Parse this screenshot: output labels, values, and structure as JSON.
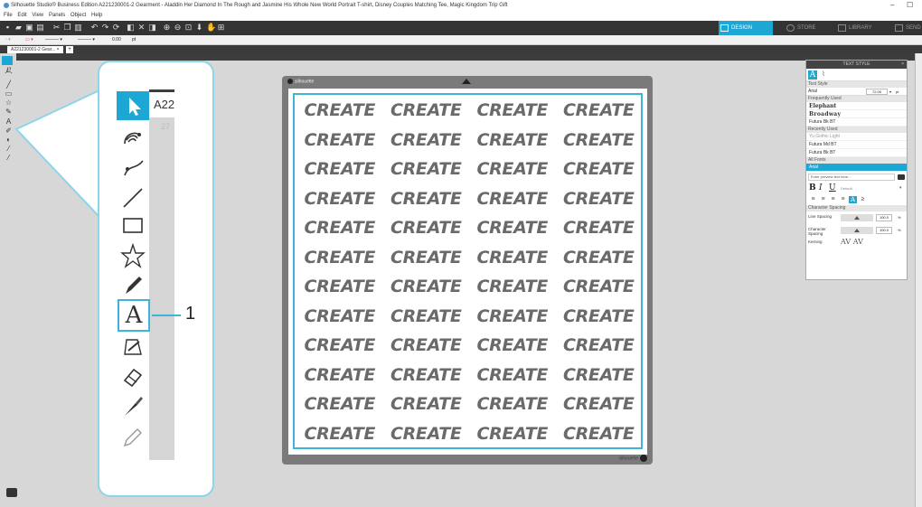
{
  "window": {
    "title": "Silhouette Studio® Business Edition A221230001-2 Gearment - Aladdin Her Diamond In The Rough and Jasmine His Whole New World Portrait T-shirt, Disney Couples Matching Tee, Magic Kingdom Trip Gift",
    "minimize": "–",
    "maximize": "☐"
  },
  "menu": [
    "File",
    "Edit",
    "View",
    "Panels",
    "Object",
    "Help"
  ],
  "mode_tabs": [
    {
      "label": "DESIGN",
      "active": true
    },
    {
      "label": "STORE",
      "active": false
    },
    {
      "label": "LIBRARY",
      "active": false
    },
    {
      "label": "SEND",
      "active": false
    }
  ],
  "options_bar": {
    "stroke_value": "0.00",
    "unit": "pt"
  },
  "doc_tab": {
    "label": "A221230001-2 Gear...",
    "close": "×",
    "add": "+"
  },
  "mat": {
    "logo": "silhouette",
    "brand": "silhouette",
    "word": "CREATE",
    "rows": 12,
    "cols": 4
  },
  "text_panel": {
    "title": "TEXT STYLE",
    "close": "×",
    "text_style_label": "Text Style",
    "font": "Arial",
    "font_size": "72.00",
    "font_unit": "pt",
    "frequently_used_label": "Frequently Used",
    "frequently_used": [
      "Elephant",
      "Broadway",
      "Futura Bk BT"
    ],
    "recently_used_label": "Recently Used",
    "recently_used": [
      "Yu Gothic Light",
      "Futura Md BT",
      "Futura Bk BT"
    ],
    "all_fonts_label": "All Fonts",
    "all_fonts": [
      "Arial"
    ],
    "preview_placeholder": "Enter preview text here...",
    "style_default": "Default",
    "char_spacing_label": "Character Spacing",
    "line_spacing_label": "Line Spacing",
    "line_spacing_value": "100.0",
    "char_spacing_label2": "Character Spacing",
    "char_spacing_value": "100.0",
    "percent": "%",
    "kerning_label": "Kerning",
    "kerning_icons": "AV AV"
  },
  "callout": {
    "tab_text": "A22",
    "ruler_num": "27",
    "number": "1",
    "text_tool_glyph": "A"
  },
  "colors": {
    "accent": "#1ca7d4",
    "cut_line": "#3db4d9",
    "callout_border": "#8fd4ea",
    "toolbar_bg": "#333333",
    "mat_bg": "#7a7a7a",
    "word_color": "#6a6a6a"
  }
}
